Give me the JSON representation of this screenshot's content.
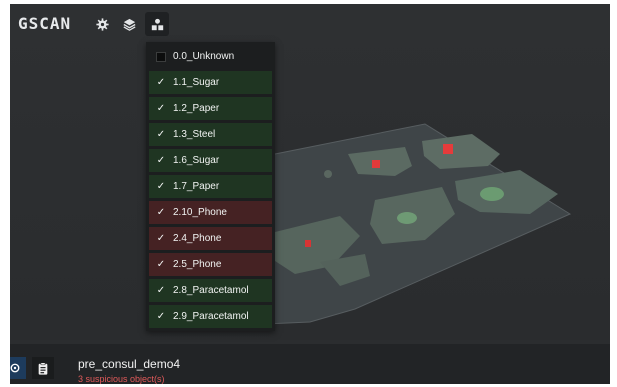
{
  "app": {
    "logo": "GSCAN"
  },
  "toolbar": {
    "settings_icon": "gear-icon",
    "layers_icon": "layers-icon",
    "categories_icon": "shapes-icon"
  },
  "categories": [
    {
      "label": "0.0_Unknown",
      "checked": false,
      "status": "neutral"
    },
    {
      "label": "1.1_Sugar",
      "checked": true,
      "status": "safe"
    },
    {
      "label": "1.2_Paper",
      "checked": true,
      "status": "safe"
    },
    {
      "label": "1.3_Steel",
      "checked": true,
      "status": "safe"
    },
    {
      "label": "1.6_Sugar",
      "checked": true,
      "status": "safe"
    },
    {
      "label": "1.7_Paper",
      "checked": true,
      "status": "safe"
    },
    {
      "label": "2.10_Phone",
      "checked": true,
      "status": "suspicious"
    },
    {
      "label": "2.4_Phone",
      "checked": true,
      "status": "suspicious"
    },
    {
      "label": "2.5_Phone",
      "checked": true,
      "status": "suspicious"
    },
    {
      "label": "2.8_Paracetamol",
      "checked": true,
      "status": "safe"
    },
    {
      "label": "2.9_Paracetamol",
      "checked": true,
      "status": "safe"
    }
  ],
  "colors": {
    "safe": "#1f3522",
    "suspicious": "#452223",
    "alert_text": "#e05a5a",
    "highlight_object": "#e83a3a"
  },
  "scan": {
    "name": "pre_consul_demo4",
    "summary": "3 suspicious object(s)"
  }
}
